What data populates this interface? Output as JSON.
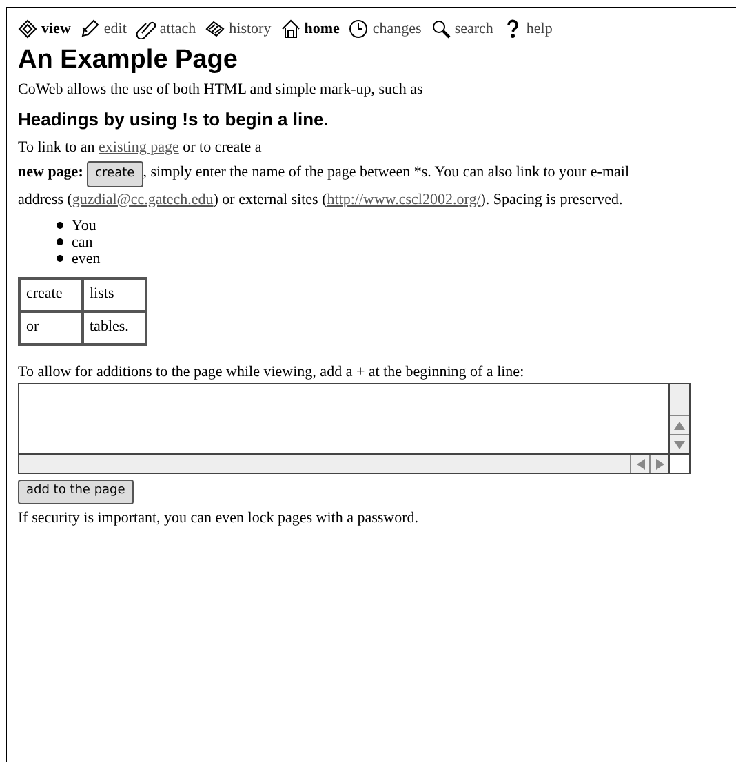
{
  "toolbar": [
    {
      "label": "view",
      "emphasized": true
    },
    {
      "label": "edit",
      "emphasized": false
    },
    {
      "label": "attach",
      "emphasized": false
    },
    {
      "label": "history",
      "emphasized": false
    },
    {
      "label": "home",
      "emphasized": true
    },
    {
      "label": "changes",
      "emphasized": false
    },
    {
      "label": "search",
      "emphasized": false
    },
    {
      "label": "help",
      "emphasized": false
    }
  ],
  "title": "An Example Page",
  "intro": "CoWeb allows the use of both HTML and simple mark-up, such as",
  "heading": "Headings by using !s to begin a line.",
  "paragraph": [
    {
      "kind": "text",
      "text": "To link to an "
    },
    {
      "kind": "link",
      "text": "existing page"
    },
    {
      "kind": "text",
      "text": " or to create a"
    },
    {
      "kind": "break"
    },
    {
      "kind": "bold",
      "text": "new page:"
    },
    {
      "kind": "button",
      "text": "create"
    },
    {
      "kind": "text",
      "text": ", simply enter the name of the page between *s. You can also link to your e-mail address ("
    },
    {
      "kind": "link",
      "text": "guzdial@cc.gatech.edu"
    },
    {
      "kind": "text",
      "text": ") or external sites ("
    },
    {
      "kind": "link",
      "text": "http://www.cscl2002.org/"
    },
    {
      "kind": "text",
      "text": "). Spacing is preserved."
    }
  ],
  "bullets": [
    "You",
    "can",
    "even"
  ],
  "table": [
    [
      "create",
      "lists"
    ],
    [
      "or",
      "tables."
    ]
  ],
  "add_prompt": "To allow for additions to the page while viewing, add a + at the beginning of a line:",
  "add_button": "add to the page",
  "footer": "If security is important, you can even lock pages with a password."
}
